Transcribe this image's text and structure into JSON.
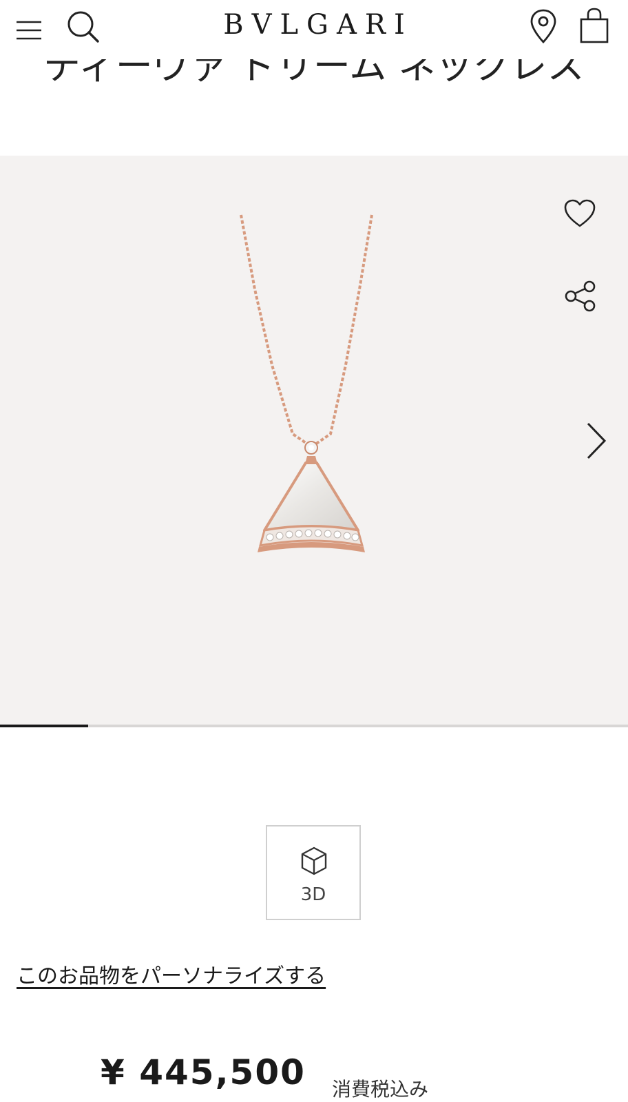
{
  "header": {
    "brand": "BVLGARI"
  },
  "product": {
    "title": "ディーヴァ ドリーム ネックレス",
    "image_progress": 0.14
  },
  "actions": {
    "view_3d_label": "3D",
    "personalize_link": "このお品物をパーソナライズする"
  },
  "pricing": {
    "price": "¥ 445,500",
    "tax_note": "消費税込み"
  },
  "colors": {
    "gallery_bg": "#f4f2f1",
    "rose_gold": "#d79a7e",
    "progress_active": "#1a1a1a"
  }
}
